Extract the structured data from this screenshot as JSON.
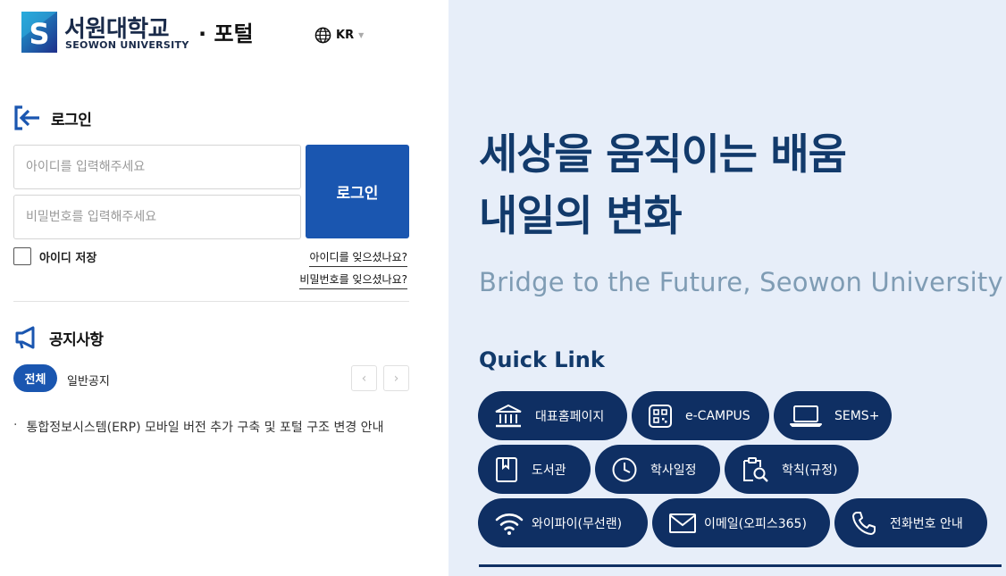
{
  "brand": {
    "name_kr": "서원대학교",
    "name_en": "SEOWON UNIVERSITY",
    "portal_title": "· 포털",
    "colors": {
      "navy": "#0f2f63",
      "blue": "#1a56b0",
      "panel": "#e7eef9"
    }
  },
  "language": {
    "icon": "globe-icon",
    "label": "KR"
  },
  "login": {
    "title": "로그인",
    "icon": "login-arrow-icon",
    "id_placeholder": "아이디를 입력해주세요",
    "pw_placeholder": "비밀번호를 입력해주세요",
    "button": "로그인",
    "save_id": "아이디 저장",
    "find_id": "아이디를 잊으셨나요?",
    "find_pw": "비밀번호를 잊으셨나요?"
  },
  "notice": {
    "title": "공지사항",
    "icon": "megaphone-icon",
    "tabs": [
      {
        "label": "전체",
        "active": true
      },
      {
        "label": "일반공지",
        "active": false
      }
    ],
    "prev": "‹",
    "next": "›",
    "items": [
      {
        "bullet": "·",
        "text": "통합정보시스템(ERP) 모바일 버전 추가 구축 및 포털 구조 변경 안내"
      }
    ]
  },
  "hero": {
    "headline_line1": "세상을 움직이는 배움",
    "headline_line2": "내일의 변화",
    "tagline": "Bridge to the Future, Seowon University"
  },
  "quick_link": {
    "title": "Quick Link",
    "items": [
      {
        "label": "대표홈페이지",
        "icon": "building-icon"
      },
      {
        "label": "e-CAMPUS",
        "icon": "qr-icon"
      },
      {
        "label": "SEMS+",
        "icon": "laptop-icon"
      },
      {
        "label": "도서관",
        "icon": "book-icon"
      },
      {
        "label": "학사일정",
        "icon": "clock-icon"
      },
      {
        "label": "학칙(규정)",
        "icon": "document-search-icon"
      },
      {
        "label": "와이파이(무선랜)",
        "icon": "wifi-icon"
      },
      {
        "label": "이메일(오피스365)",
        "icon": "mail-icon"
      },
      {
        "label": "전화번호 안내",
        "icon": "phone-icon"
      }
    ]
  }
}
